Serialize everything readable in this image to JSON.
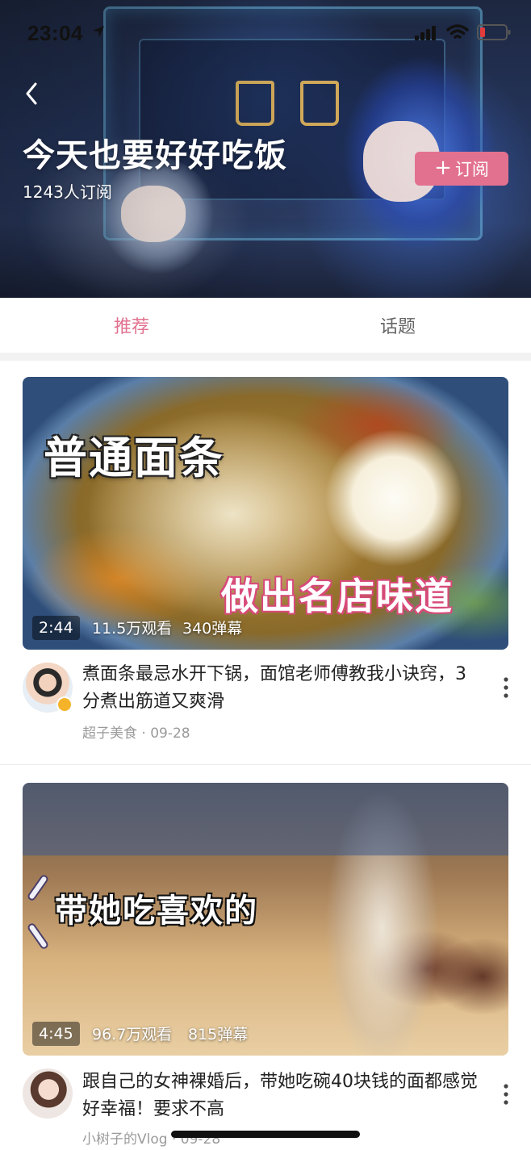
{
  "status_bar": {
    "time": "23:04",
    "icons": [
      "location-arrow-icon",
      "cellular-signal-icon",
      "wifi-icon",
      "battery-icon"
    ]
  },
  "header": {
    "back_icon": "chevron-left-icon",
    "title": "今天也要好好吃饭",
    "subscribers": "1243人订阅",
    "subscribe_button": {
      "icon": "plus-icon",
      "icon_glyph": "+",
      "label": "订阅"
    }
  },
  "tabs": [
    {
      "label": "推荐",
      "active": true
    },
    {
      "label": "话题",
      "active": false
    }
  ],
  "colors": {
    "accent": "#e2718f",
    "tab_inactive": "#666666",
    "meta_text": "#9a9a9a",
    "verified_badge": "#f5b32a"
  },
  "videos": [
    {
      "thumbnail_text": [
        "普通面条",
        "做出名店味道"
      ],
      "duration": "2:44",
      "views": "11.5万观看",
      "danmaku": "340弹幕",
      "title": "煮面条最忌水开下锅，面馆老师傅教我小诀窍，3分煮出筋道又爽滑",
      "author": "超子美食",
      "date": "09-28",
      "verified": true
    },
    {
      "thumbnail_text": [
        "带她吃喜欢的"
      ],
      "duration": "4:45",
      "views": "96.7万观看",
      "danmaku": "815弹幕",
      "title": "跟自己的女神裸婚后，带她吃碗40块钱的面都感觉好幸福！要求不高",
      "author": "小树子的Vlog",
      "date": "09-28",
      "verified": false
    }
  ],
  "meta_separator": " · ",
  "more_icon": "more-vertical-icon"
}
